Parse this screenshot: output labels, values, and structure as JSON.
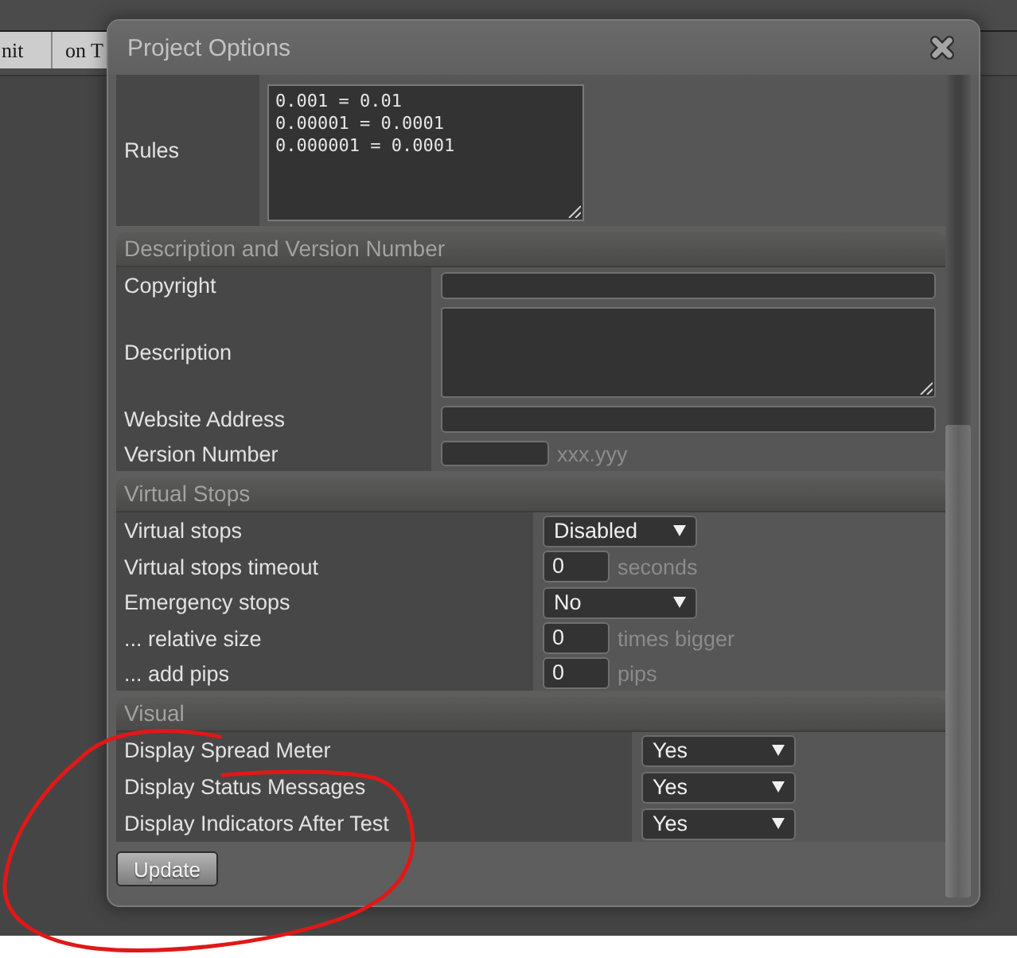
{
  "background_tabs": [
    {
      "label": "nit"
    },
    {
      "label": "on T"
    }
  ],
  "dialog": {
    "title": "Project Options",
    "sections": [
      {
        "rows": [
          {
            "kind": "code",
            "label": "Rules",
            "value": "0.001 = 0.01\n0.00001 = 0.0001\n0.000001 = 0.0001"
          }
        ]
      },
      {
        "title": "Description and Version Number",
        "rows": [
          {
            "kind": "text",
            "label": "Copyright"
          },
          {
            "kind": "textarea",
            "label": "Description"
          },
          {
            "kind": "text",
            "label": "Website Address"
          },
          {
            "kind": "short",
            "label": "Version Number",
            "suffix": "xxx.yyy"
          }
        ]
      },
      {
        "title": "Virtual Stops",
        "rows": [
          {
            "kind": "select",
            "label": "Virtual stops",
            "value": "Disabled"
          },
          {
            "kind": "number",
            "label": "Virtual stops timeout",
            "value": "0",
            "suffix": "seconds"
          },
          {
            "kind": "select",
            "label": "Emergency stops",
            "value": "No"
          },
          {
            "kind": "number",
            "label": "... relative size",
            "value": "0",
            "suffix": "times bigger"
          },
          {
            "kind": "number",
            "label": "... add pips",
            "value": "0",
            "suffix": "pips"
          }
        ]
      },
      {
        "title": "Visual",
        "rows": [
          {
            "kind": "select",
            "label": "Display Spread Meter",
            "value": "Yes"
          },
          {
            "kind": "select",
            "label": "Display Status Messages",
            "value": "Yes"
          },
          {
            "kind": "select",
            "label": "Display Indicators After Test",
            "value": "Yes"
          }
        ]
      }
    ],
    "button": "Update"
  },
  "annotations": [
    {
      "kind": "freehand-loop"
    }
  ]
}
